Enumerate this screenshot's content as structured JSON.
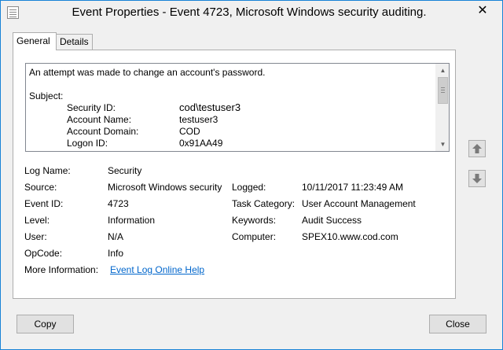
{
  "window": {
    "title": "Event Properties - Event 4723, Microsoft Windows security auditing.",
    "close_glyph": "✕"
  },
  "tabs": [
    {
      "label": "General",
      "active": true
    },
    {
      "label": "Details",
      "active": false
    }
  ],
  "description": {
    "line1": "An attempt was made to change an account's password.",
    "subject_label": "Subject:",
    "rows": [
      {
        "label": "Security ID:",
        "value": "cod\\testuser3"
      },
      {
        "label": "Account Name:",
        "value": "testuser3"
      },
      {
        "label": "Account Domain:",
        "value": "COD"
      },
      {
        "label": "Logon ID:",
        "value": "0x91AA49"
      }
    ]
  },
  "fields": {
    "log_name": {
      "label": "Log Name:",
      "value": "Security"
    },
    "source": {
      "label": "Source:",
      "value": "Microsoft Windows security"
    },
    "logged": {
      "label": "Logged:",
      "value": "10/11/2017 11:23:49 AM"
    },
    "event_id": {
      "label": "Event ID:",
      "value": "4723"
    },
    "task_category": {
      "label": "Task Category:",
      "value": "User Account Management"
    },
    "level": {
      "label": "Level:",
      "value": "Information"
    },
    "keywords": {
      "label": "Keywords:",
      "value": "Audit Success"
    },
    "user": {
      "label": "User:",
      "value": "N/A"
    },
    "computer": {
      "label": "Computer:",
      "value": "SPEX10.www.cod.com"
    },
    "opcode": {
      "label": "OpCode:",
      "value": "Info"
    },
    "more_info": {
      "label": "More Information:",
      "link": "Event Log Online Help"
    }
  },
  "buttons": {
    "copy": "Copy",
    "close": "Close"
  },
  "icons": {
    "app": "event-properties-icon",
    "scroll_up": "▲",
    "scroll_down": "▼"
  },
  "colors": {
    "window_border": "#1883d7",
    "link": "#0066cc",
    "nav_arrow": "#7a7a7a"
  }
}
